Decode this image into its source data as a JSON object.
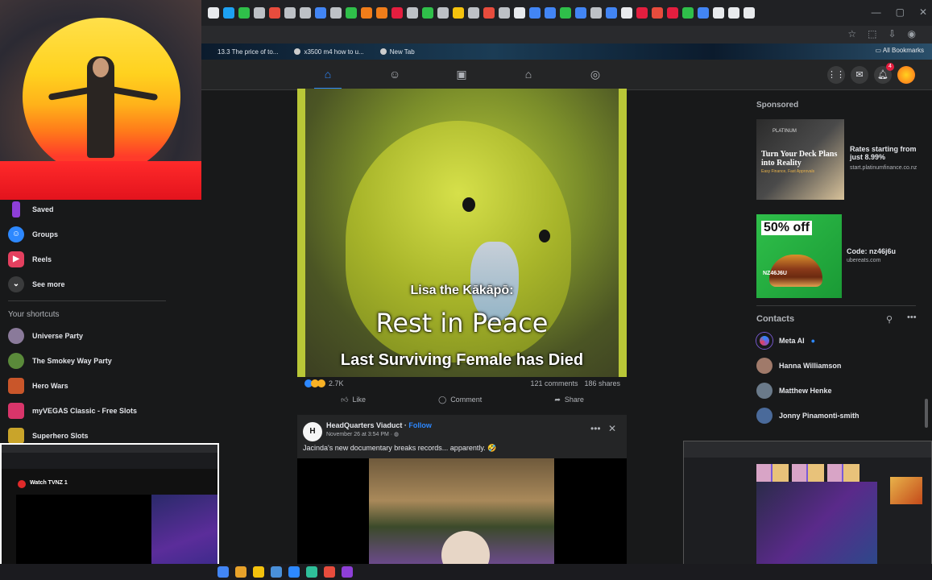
{
  "browser": {
    "tabs": [
      {
        "color": "#e8eaed"
      },
      {
        "color": "#1da1f2"
      },
      {
        "color": "#2fbf4a"
      },
      {
        "color": "#bdc1c6"
      },
      {
        "color": "#e84c3d"
      },
      {
        "color": "#bdc1c6"
      },
      {
        "color": "#bdc1c6"
      },
      {
        "color": "#4285f4"
      },
      {
        "color": "#bdc1c6"
      },
      {
        "color": "#2fbf4a"
      },
      {
        "color": "#f07d1a"
      },
      {
        "color": "#f07d1a"
      },
      {
        "color": "#e41e3f"
      },
      {
        "color": "#bdc1c6"
      },
      {
        "color": "#2fbf4a"
      },
      {
        "color": "#bdc1c6"
      },
      {
        "color": "#f4c20d"
      },
      {
        "color": "#bdc1c6"
      },
      {
        "color": "#e84c3d"
      },
      {
        "color": "#bdc1c6"
      },
      {
        "color": "#e8eaed"
      },
      {
        "color": "#4285f4"
      },
      {
        "color": "#4285f4"
      },
      {
        "color": "#2fbf4a"
      },
      {
        "color": "#4285f4"
      },
      {
        "color": "#bdc1c6"
      },
      {
        "color": "#4285f4"
      },
      {
        "color": "#e8eaed"
      },
      {
        "color": "#e41e3f"
      },
      {
        "color": "#e84c3d"
      },
      {
        "color": "#e41e3f"
      },
      {
        "color": "#2fbf4a"
      },
      {
        "color": "#4285f4"
      },
      {
        "color": "#e8eaed"
      },
      {
        "color": "#e8eaed"
      },
      {
        "color": "#e8eaed"
      }
    ],
    "bookmarks": [
      {
        "label": "13.3 The price of to..."
      },
      {
        "label": "x3500 m4 how to u..."
      },
      {
        "label": "New Tab"
      }
    ],
    "all_bookmarks": "All Bookmarks",
    "window_controls": [
      "—",
      "▢",
      "✕"
    ]
  },
  "nav": {
    "notifications_count": "4",
    "accent_color": "#2d88ff"
  },
  "sidebar": {
    "items": [
      {
        "label": "Saved",
        "color": "#8e3fd8",
        "icon": "bookmark-icon"
      },
      {
        "label": "Groups",
        "color": "#2d88ff",
        "icon": "groups-icon"
      },
      {
        "label": "Reels",
        "color": "#e4405f",
        "icon": "reels-icon"
      },
      {
        "label": "See more",
        "color": "#3a3b3c",
        "icon": "chevron-down-icon"
      }
    ],
    "shortcuts_title": "Your shortcuts",
    "shortcuts": [
      {
        "label": "Universe Party",
        "color": "#8a7a9a"
      },
      {
        "label": "The Smokey Way Party",
        "color": "#5a8a3a"
      },
      {
        "label": "Hero Wars",
        "color": "#c9562a"
      },
      {
        "label": "myVEGAS Classic - Free Slots",
        "color": "#d8356a"
      },
      {
        "label": "Superhero Slots",
        "color": "#c9a42a"
      }
    ]
  },
  "post1": {
    "caption_line1": "Lisa the Kākāpō:",
    "caption_line2": "Rest in Peace",
    "caption_line3": "Last Surviving Female has Died",
    "reaction_count": "2.7K",
    "comments": "121 comments",
    "shares": "186 shares",
    "like_label": "Like",
    "comment_label": "Comment",
    "share_label": "Share"
  },
  "post2": {
    "page_name": "HeadQuarters Viaduct",
    "separator": " · ",
    "follow": "Follow",
    "date": "November 26 at 3:54 PM · ",
    "text": "Jacinda's new documentary breaks records... apparently. 🤣"
  },
  "right": {
    "sponsored": "Sponsored",
    "ad1": {
      "image_brand": "PLATINUM",
      "image_headline": "Turn Your Deck Plans into Reality",
      "image_sub": "Easy Finance, Fast Approvals",
      "title": "Rates starting from just 8.99%",
      "url": "start.platinumfinance.co.nz"
    },
    "ad2": {
      "image_offer": "50% off",
      "image_code": "NZ46J6U",
      "title": "Code: nz46j6u",
      "url": "ubereats.com"
    },
    "contacts_title": "Contacts",
    "contacts": [
      {
        "name": "Meta AI",
        "color": "#7a5ad6"
      },
      {
        "name": "Hanna Williamson",
        "color": "#a07a6a"
      },
      {
        "name": "Matthew Henke",
        "color": "#6a7a8a"
      },
      {
        "name": "Jonny Pinamonti-smith",
        "color": "#4a6a9a"
      }
    ]
  },
  "overlay_left": {
    "title": "Watch TVNZ 1"
  },
  "taskbar": {
    "apps": [
      {
        "color": "#4285f4"
      },
      {
        "color": "#e8a22a"
      },
      {
        "color": "#f4c20d"
      },
      {
        "color": "#4a90d9"
      },
      {
        "color": "#2d88ff"
      },
      {
        "color": "#2fbf9a"
      },
      {
        "color": "#e84c3d"
      },
      {
        "color": "#8e3fd8"
      }
    ]
  }
}
